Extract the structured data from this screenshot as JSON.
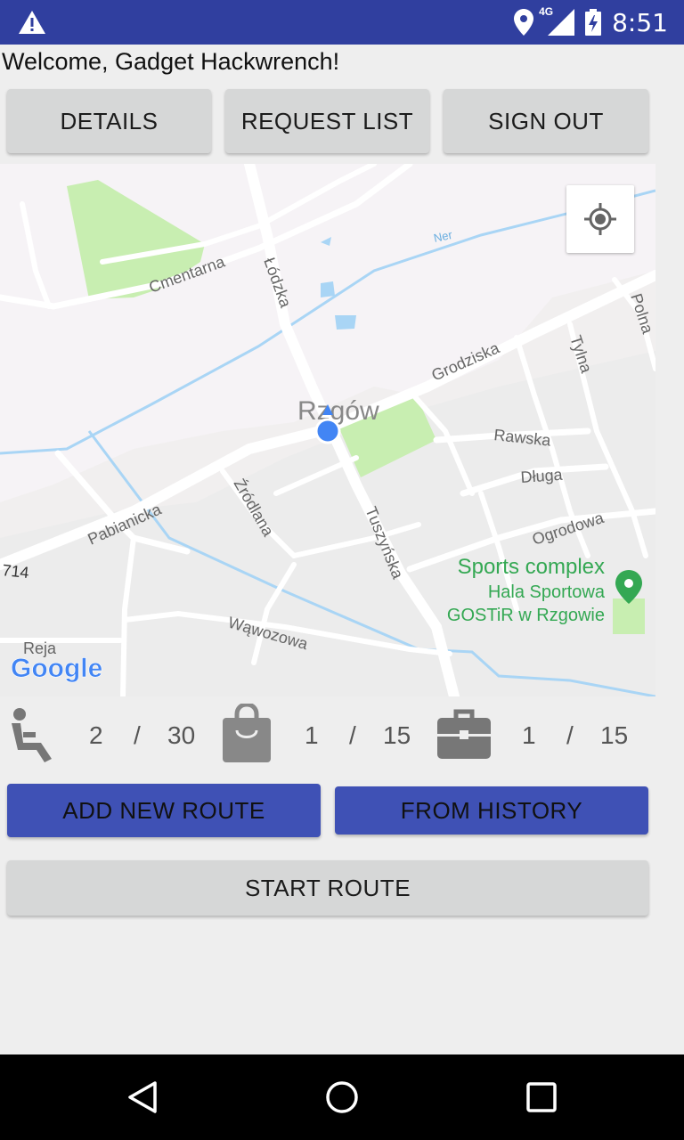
{
  "status_bar": {
    "time": "8:51",
    "network": "4G"
  },
  "welcome_text": "Welcome, Gadget Hackwrench!",
  "top_buttons": {
    "details": "DETAILS",
    "request_list": "REQUEST LIST",
    "sign_out": "SIGN OUT"
  },
  "map": {
    "town": "Rzgów",
    "streets": [
      "Łódzka",
      "Cmentarna",
      "Ner",
      "Grodziska",
      "Tylna",
      "Polna",
      "Rawska",
      "Długa",
      "Ogrodowa",
      "Pabianicka",
      "Źródlana",
      "Tuszyńska",
      "Wąwozowa",
      "Reja",
      "714"
    ],
    "poi": {
      "name": "Sports complex",
      "line1": "Hala Sportowa",
      "line2": "GOSTiR w Rzgowie"
    },
    "attribution": "Google"
  },
  "counters": {
    "seats": {
      "used": "2",
      "sep": "/",
      "total": "30"
    },
    "bags": {
      "used": "1",
      "sep": "/",
      "total": "15"
    },
    "luggage": {
      "used": "1",
      "sep": "/",
      "total": "15"
    }
  },
  "route_buttons": {
    "add_new": "ADD NEW ROUTE",
    "from_history": "FROM HISTORY",
    "start": "START ROUTE"
  },
  "colors": {
    "primary": "#3f51b5",
    "status_bar": "#303f9f",
    "park": "#c8eeb1",
    "water": "#a9d5f5",
    "poi": "#34a853"
  }
}
